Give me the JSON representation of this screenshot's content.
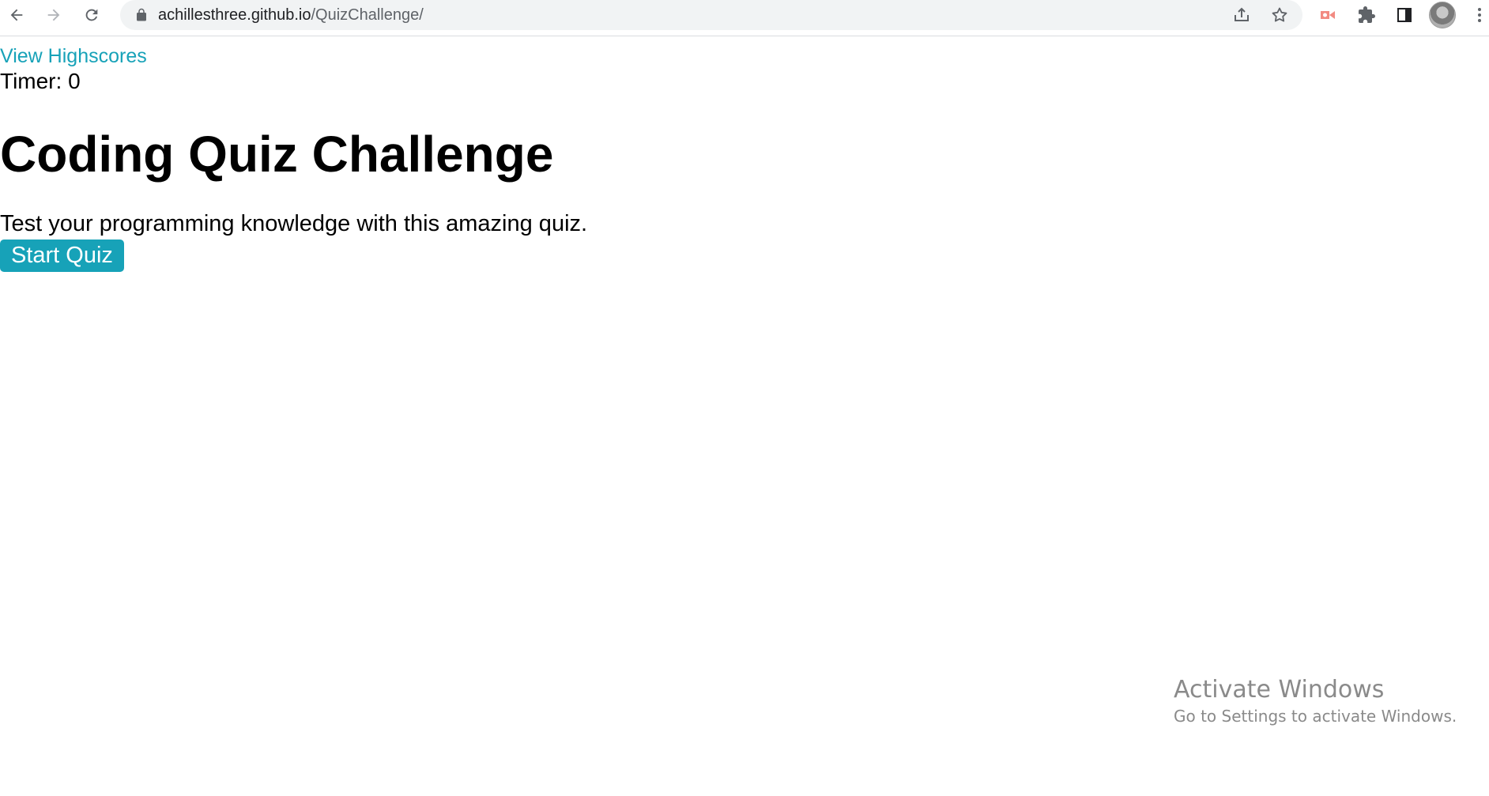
{
  "browser": {
    "url_host": "achillesthree.github.io",
    "url_path": "/QuizChallenge/",
    "icons": {
      "back": "arrow-left-icon",
      "forward": "arrow-right-icon",
      "reload": "reload-icon",
      "lock": "lock-icon",
      "share": "share-icon",
      "bookmark": "star-icon",
      "extension_red": "record-extension-icon",
      "extensions": "puzzle-icon",
      "side_panel": "side-panel-icon",
      "profile": "avatar",
      "menu": "kebab-menu-icon"
    }
  },
  "page": {
    "highscores_link": "View Highscores",
    "timer_label": "Timer: 0",
    "title": "Coding Quiz Challenge",
    "description": "Test your programming knowledge with this amazing quiz.",
    "start_button": "Start Quiz",
    "accent_color": "#17a2b8"
  },
  "os_overlay": {
    "activate_title": "Activate Windows",
    "activate_subtitle": "Go to Settings to activate Windows."
  }
}
